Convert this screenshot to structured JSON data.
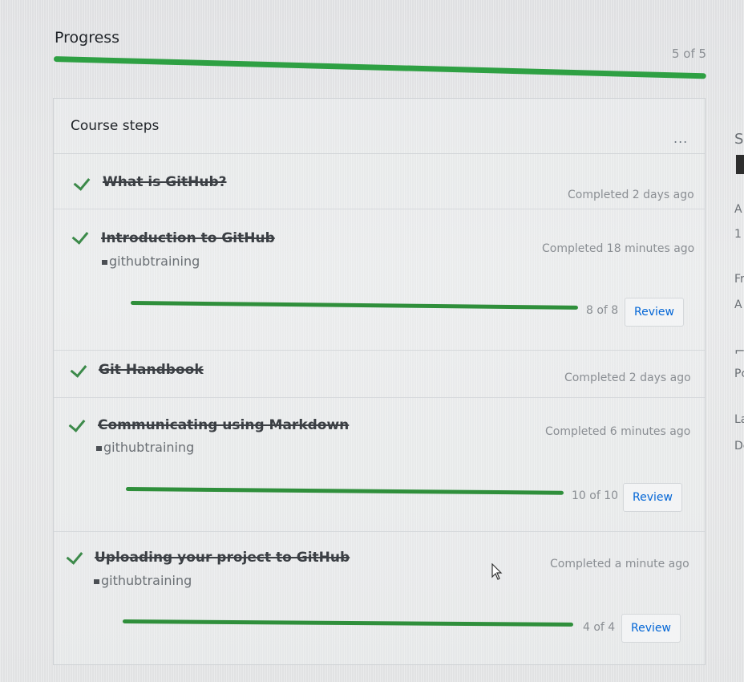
{
  "progress": {
    "title": "Progress",
    "count": "5 of 5",
    "fraction": 1.0
  },
  "course_steps": {
    "title": "Course steps",
    "menu_label": "...",
    "steps": [
      {
        "title": "What is GitHub?",
        "status": "Completed 2 days ago"
      },
      {
        "title": "Introduction to GitHub",
        "org": "githubtraining",
        "status": "Completed 18 minutes ago",
        "progress_count": "8 of 8",
        "progress_fraction": 1.0,
        "review_label": "Review"
      },
      {
        "title": "Git Handbook",
        "status": "Completed 2 days ago"
      },
      {
        "title": "Communicating using Markdown",
        "org": "githubtraining",
        "status": "Completed 6 minutes ago",
        "progress_count": "10 of 10",
        "progress_fraction": 1.0,
        "review_label": "Review"
      },
      {
        "title": "Uploading your project to GitHub",
        "org": "githubtraining",
        "status": "Completed a minute ago",
        "progress_count": "4 of 4",
        "progress_fraction": 1.0,
        "review_label": "Review"
      }
    ]
  },
  "sidebar_fragments": [
    "S",
    "A",
    "1",
    "Fr",
    "A",
    "Pc",
    "La",
    "De"
  ],
  "colors": {
    "progress_green": "#2ea043",
    "link_blue": "#0366d6",
    "check_green": "#3c8a4a"
  }
}
